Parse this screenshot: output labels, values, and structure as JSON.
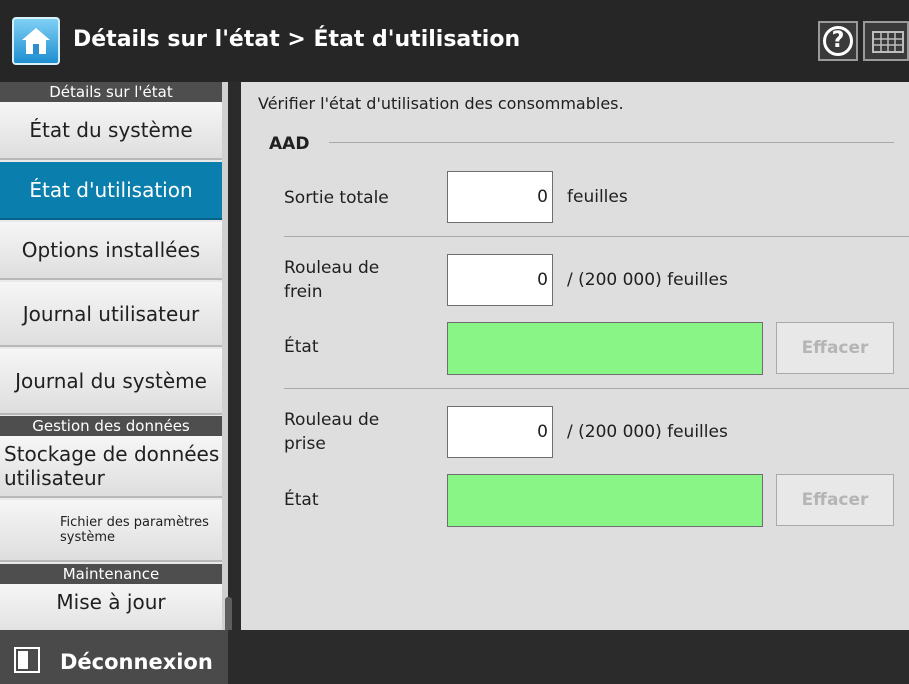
{
  "header": {
    "title": "Détails sur l'état > État d'utilisation",
    "icons": {
      "home": "home-icon",
      "help": "help-icon",
      "keyboard": "keyboard-icon"
    },
    "help_glyph": "?"
  },
  "sidebar": {
    "section_status": "Détails sur l'état",
    "item_system_status": "État du système",
    "item_usage_status": "État d'utilisation",
    "item_installed_options": "Options installées",
    "item_user_log": "Journal utilisateur",
    "item_system_log": "Journal du système",
    "section_data": "Gestion des données",
    "item_user_data_storage": "Stockage de données utilisateur",
    "item_system_settings_file": "Fichier des paramètres système",
    "section_maintenance": "Maintenance",
    "item_update": "Mise à jour"
  },
  "main": {
    "description": "Vérifier l'état d'utilisation des consommables.",
    "group_title": "AAD",
    "total_output": {
      "label": "Sortie totale",
      "value": "0",
      "unit": "feuilles"
    },
    "brake_roller": {
      "label": "Rouleau de frein",
      "value": "0",
      "unit": "/ (200 000) feuilles",
      "status_label": "État",
      "clear_button": "Effacer"
    },
    "pick_roller": {
      "label": "Rouleau de prise",
      "value": "0",
      "unit": "/ (200 000) feuilles",
      "status_label": "État",
      "clear_button": "Effacer"
    },
    "status_color": "#88f586"
  },
  "footer": {
    "logout_label": "Déconnexion",
    "logout_icon": "logout-icon"
  },
  "colors": {
    "accent": "#0a7fae",
    "header_bg": "#262626"
  }
}
